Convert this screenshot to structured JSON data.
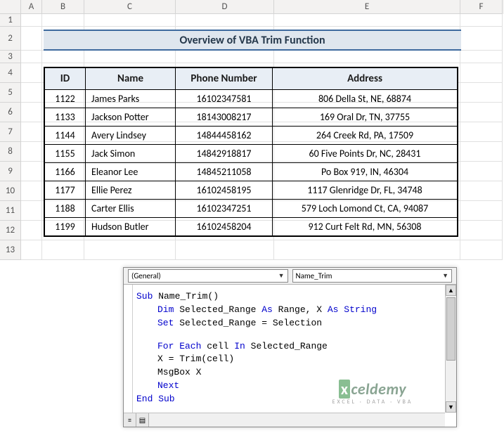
{
  "columns": [
    "A",
    "B",
    "C",
    "D",
    "E",
    "F"
  ],
  "rows": [
    "1",
    "2",
    "3",
    "4",
    "5",
    "6",
    "7",
    "8",
    "9",
    "10",
    "11",
    "12",
    "13"
  ],
  "title": "Overview of VBA Trim Function",
  "table": {
    "headers": [
      "ID",
      "Name",
      "Phone Number",
      "Address"
    ],
    "data": [
      {
        "id": "1122",
        "name": "James Parks",
        "phone": "16102347581",
        "addr": "806 Della St, NE, 68874"
      },
      {
        "id": "1133",
        "name": "Jackson   Potter",
        "phone": "18143008217",
        "addr": "169 Oral Dr, TN, 37755"
      },
      {
        "id": "1144",
        "name": "Avery Lindsey",
        "phone": "14844458162",
        "addr": "264 Creek Rd, PA, 17509"
      },
      {
        "id": "1155",
        "name": "Jack   Simon",
        "phone": "14842918817",
        "addr": "60 Five Points Dr, NC, 28431"
      },
      {
        "id": "1166",
        "name": "Eleanor Lee",
        "phone": "14845211058",
        "addr": "Po Box 919, IN, 46304"
      },
      {
        "id": "1177",
        "name": "Ellie Perez",
        "phone": "16102458195",
        "addr": "1117 Glenridge Dr, FL, 34748"
      },
      {
        "id": "1188",
        "name": "Carter Ellis",
        "phone": "16102347251",
        "addr": "579 Loch Lomond Ct, CA, 94087"
      },
      {
        "id": "1199",
        "name": "Hudson   Butler",
        "phone": "16102458204",
        "addr": "912 Curt Felt Rd, MN, 56308"
      }
    ]
  },
  "vba": {
    "combo_left": "(General)",
    "combo_right": "Name_Trim",
    "code": {
      "l1_kw": "Sub",
      "l1_rest": " Name_Trim()",
      "l2_kw": "Dim",
      "l2_rest": " Selected_Range ",
      "l2_kw2": "As",
      "l2_rest2": " Range, X ",
      "l2_kw3": "As String",
      "l3_kw": "Set",
      "l3_rest": " Selected_Range = Selection",
      "l4_kw": "For Each",
      "l4_rest": " cell ",
      "l4_kw2": "In",
      "l4_rest2": " Selected_Range",
      "l5": " X = Trim(cell)",
      "l6": " MsgBox X",
      "l7_kw": "Next",
      "l8_kw": "End Sub"
    }
  },
  "watermark": {
    "brand_x": "x",
    "brand_rest": "celdemy",
    "sub": "EXCEL · DATA · VBA"
  }
}
